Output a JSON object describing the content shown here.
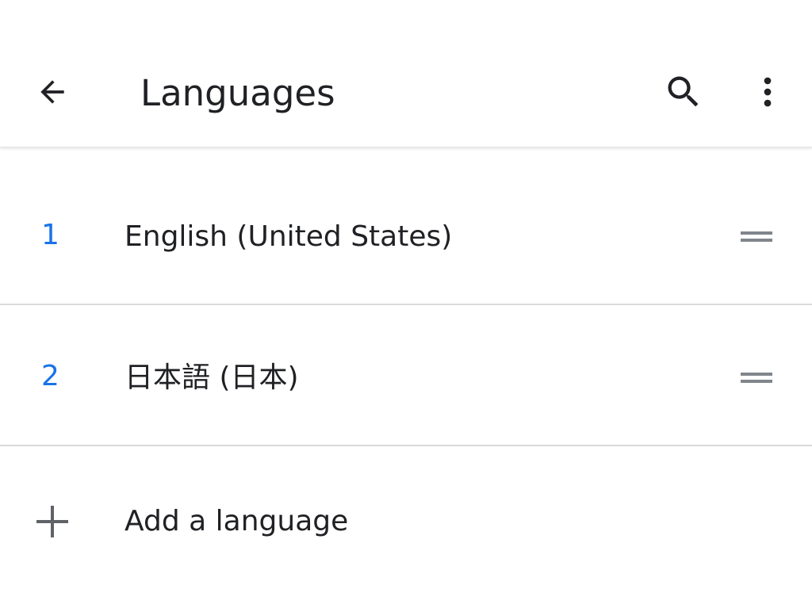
{
  "toolbar": {
    "title": "Languages",
    "back_icon": "arrow-back-icon",
    "search_icon": "search-icon",
    "more_icon": "more-vert-icon"
  },
  "languages": [
    {
      "number": "1",
      "label": "English (United States)"
    },
    {
      "number": "2",
      "label": "日本語 (日本)"
    }
  ],
  "add_language": {
    "label": "Add a language",
    "icon": "plus-icon"
  },
  "colors": {
    "accent": "#1a73e8",
    "text": "#202124",
    "icon": "#3c4043",
    "handle": "#80868b",
    "divider": "#dadada"
  }
}
